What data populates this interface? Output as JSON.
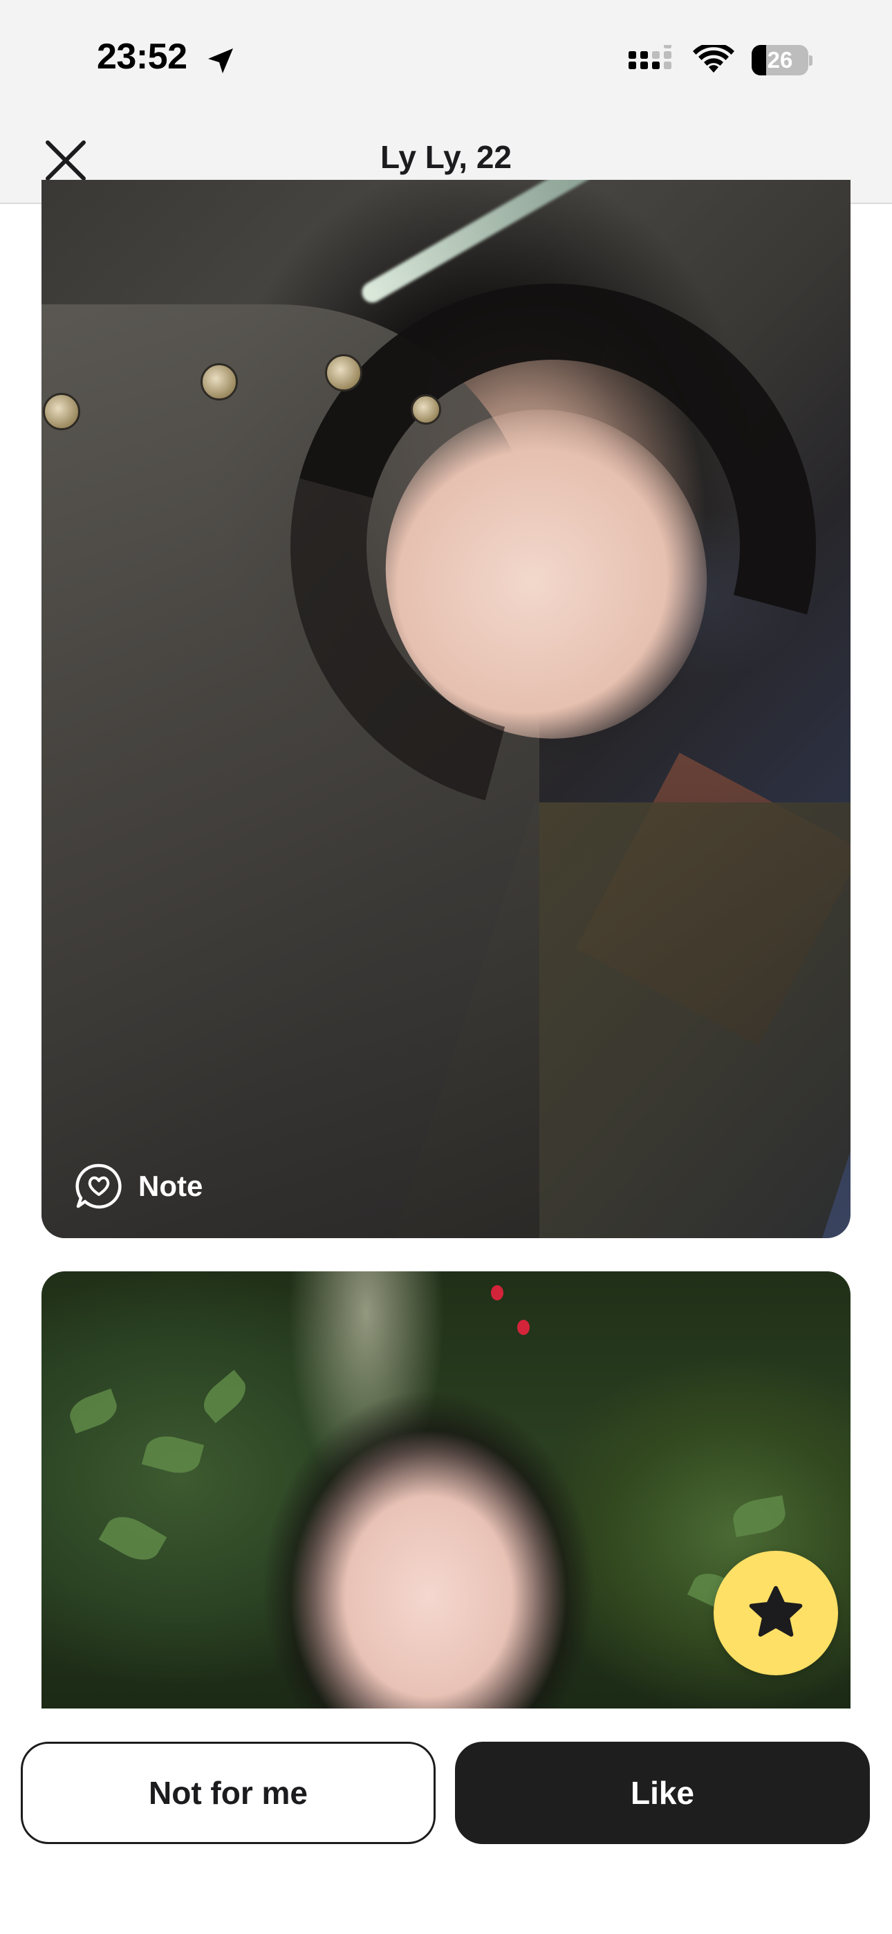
{
  "status_bar": {
    "time": "23:52",
    "location_icon": "location-arrow-icon",
    "signal_icon": "cellular-signal-icon",
    "wifi_icon": "wifi-icon",
    "battery_level": "26",
    "battery_fraction": 0.26
  },
  "header": {
    "title": "Ly Ly, 22",
    "close_icon": "close-icon"
  },
  "photos": [
    {
      "badge": {
        "icon": "heart-speech-bubble-icon",
        "label": "Note"
      }
    },
    {}
  ],
  "super_like": {
    "icon": "star-icon",
    "color": "#ffe066"
  },
  "actions": {
    "pass_label": "Not for me",
    "like_label": "Like"
  },
  "colors": {
    "like_button": "#1e1e1e",
    "super_like": "#ffe066",
    "header_bg": "#f3f3f3"
  }
}
